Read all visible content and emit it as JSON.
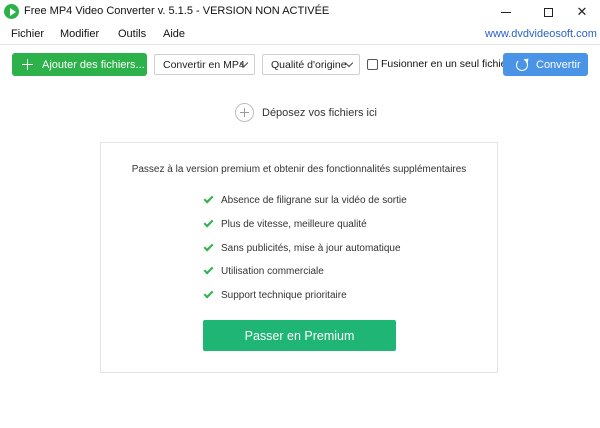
{
  "window": {
    "title": "Free MP4 Video Converter v. 5.1.5 - VERSION NON ACTIVÉE",
    "icon": "app-logo-icon"
  },
  "menu": {
    "items": [
      "Fichier",
      "Modifier",
      "Outils",
      "Aide"
    ],
    "site_link": "www.dvdvideosoft.com"
  },
  "toolbar": {
    "add_label": "Ajouter des fichiers...",
    "format_value": "Convertir en MP4",
    "quality_value": "Qualité d'origine",
    "merge_label": "Fusionner en un seul fichier",
    "merge_checked": false,
    "convert_label": "Convertir"
  },
  "dropzone": {
    "text": "Déposez vos fichiers ici"
  },
  "premium": {
    "heading": "Passez à la version premium et obtenir des fonctionnalités supplémentaires",
    "features": [
      "Absence de filigrane sur la vidéo de sortie",
      "Plus de vitesse, meilleure qualité",
      "Sans publicités, mise à jour automatique",
      "Utilisation commerciale",
      "Support technique prioritaire"
    ],
    "button_label": "Passer en Premium"
  },
  "colors": {
    "add_button": "#2db14b",
    "convert_button": "#4a94e8",
    "premium_button": "#1fb574",
    "link": "#2a62c9"
  }
}
